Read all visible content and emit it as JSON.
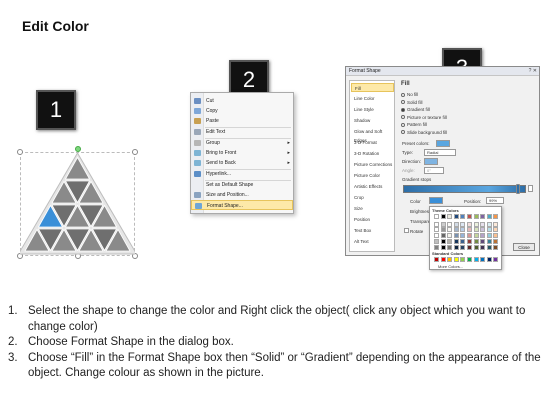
{
  "title": "Edit Color",
  "steps": [
    "1",
    "2",
    "3"
  ],
  "context_menu": {
    "items": [
      {
        "label": "Cut",
        "icon": "scissors-icon",
        "color": "#6b8fc2"
      },
      {
        "label": "Copy",
        "icon": "copy-icon",
        "color": "#7ea7d8"
      },
      {
        "label": "Paste",
        "icon": "paste-icon",
        "color": "#c8a052"
      },
      {
        "label": "Edit Text",
        "icon": "edit-text-icon",
        "color": "#9aa7b8"
      },
      {
        "label": "Group",
        "icon": "group-icon",
        "color": "#b6b6b6",
        "submenu": true
      },
      {
        "label": "Bring to Front",
        "icon": "bring-front-icon",
        "color": "#7eb4d4",
        "submenu": true
      },
      {
        "label": "Send to Back",
        "icon": "send-back-icon",
        "color": "#7eb4d4",
        "submenu": true
      },
      {
        "label": "Hyperlink...",
        "icon": "hyperlink-icon",
        "color": "#5b8ec7"
      },
      {
        "label": "Set as Default Shape",
        "icon": "",
        "color": ""
      },
      {
        "label": "Size and Position...",
        "icon": "size-position-icon",
        "color": "#8aa3c0"
      },
      {
        "label": "Format Shape...",
        "icon": "format-shape-icon",
        "color": "#6fa6d6"
      }
    ]
  },
  "dialog": {
    "title": "Format Shape",
    "window_buttons": "? ✕",
    "nav": [
      "Fill",
      "Line Color",
      "Line Style",
      "Shadow",
      "Glow and Soft Edges",
      "3-D Format",
      "3-D Rotation",
      "Picture Corrections",
      "Picture Color",
      "Artistic Effects",
      "Crop",
      "Size",
      "Position",
      "Text Box",
      "Alt Text"
    ],
    "fill_heading": "Fill",
    "fill_options": [
      {
        "label": "No fill",
        "selected": false
      },
      {
        "label": "Solid fill",
        "selected": false
      },
      {
        "label": "Gradient fill",
        "selected": true
      },
      {
        "label": "Picture or texture fill",
        "selected": false
      },
      {
        "label": "Pattern fill",
        "selected": false
      },
      {
        "label": "Slide background fill",
        "selected": false
      }
    ],
    "preset_colors": "Preset colors:",
    "type_label": "Type:",
    "type_value": "Radial",
    "direction_label": "Direction:",
    "angle_label": "Angle:",
    "angle_value": "0°",
    "gradient_stops": "Gradient stops",
    "color_label": "Color",
    "position_label": "Position:",
    "position_value": "99%",
    "brightness_label": "Brightness",
    "transparency_label": "Transparen",
    "rotate_label": "Rotate",
    "close_button": "Close"
  },
  "palette": {
    "theme_heading": "Theme Colors",
    "standard_heading": "Standard Colors",
    "more_colors": "More Colors...",
    "theme_top": [
      "#ffffff",
      "#000000",
      "#eeece1",
      "#1f497d",
      "#4f81bd",
      "#c0504d",
      "#9bbb59",
      "#8064a2",
      "#4bacc6",
      "#f79646"
    ],
    "standard": [
      "#c00000",
      "#ff0000",
      "#ffc000",
      "#ffff00",
      "#92d050",
      "#00b050",
      "#00b0f0",
      "#0070c0",
      "#002060",
      "#7030a0"
    ]
  },
  "instructions": [
    {
      "num": "1.",
      "text": "Select the shape to change the color and Right click the object( click any object which you want to change color)"
    },
    {
      "num": "2.",
      "text": "Choose Format Shape in the dialog box."
    },
    {
      "num": "3.",
      "text": "Choose “Fill” in the Format Shape box then “Solid” or “Gradient” depending on the appearance of the object. Change colour as shown in the picture."
    }
  ],
  "colors": {
    "selected_triangle": "#3a8fd8",
    "triangle_gray": "#8a8a8a"
  }
}
